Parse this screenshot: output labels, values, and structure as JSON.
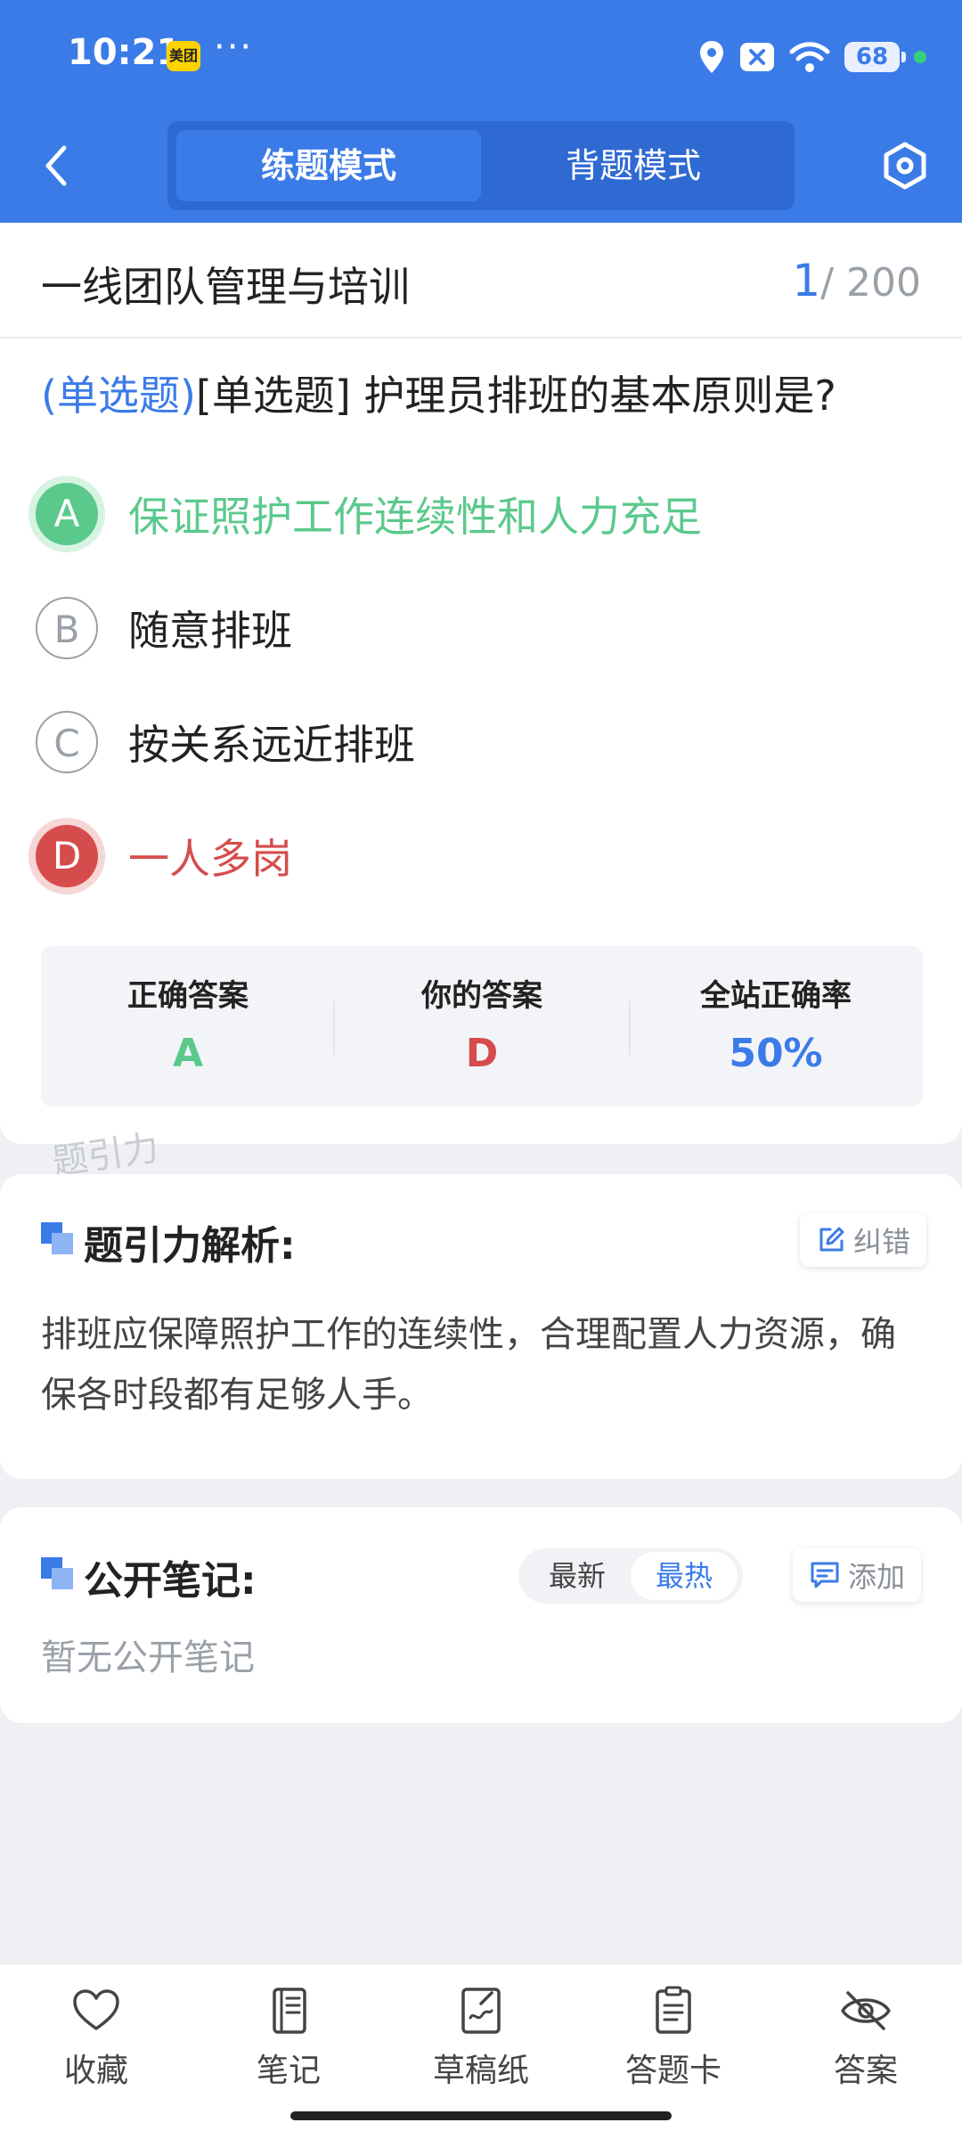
{
  "status_bar": {
    "time": "10:21",
    "app_badge": "美团",
    "more": "···",
    "battery": "68",
    "icons": [
      "location-icon",
      "close-notification-icon",
      "wifi-icon",
      "battery-icon"
    ]
  },
  "header": {
    "tabs": [
      {
        "label": "练题模式",
        "active": true
      },
      {
        "label": "背题模式",
        "active": false
      }
    ],
    "back_icon": "chevron-left-icon",
    "settings_icon": "hexagon-settings-icon"
  },
  "question_card": {
    "course_title": "一线团队管理与培训",
    "counter_current": "1",
    "counter_total": "/ 200",
    "question_type": "(单选题)",
    "question_text": "[单选题] 护理员排班的基本原则是?",
    "options": [
      {
        "letter": "A",
        "text": "保证照护工作连续性和人力充足",
        "state": "correct"
      },
      {
        "letter": "B",
        "text": "随意排班",
        "state": "normal"
      },
      {
        "letter": "C",
        "text": "按关系远近排班",
        "state": "normal"
      },
      {
        "letter": "D",
        "text": "一人多岗",
        "state": "wrong"
      }
    ],
    "stats": [
      {
        "label": "正确答案",
        "value": "A",
        "color": "#5bc98c"
      },
      {
        "label": "你的答案",
        "value": "D",
        "color": "#d64c4c"
      },
      {
        "label": "全站正确率",
        "value": "50%",
        "color": "#3b7be8"
      }
    ],
    "watermark": "题引力"
  },
  "analysis": {
    "title": "题引力解析:",
    "report_button": "纠错",
    "text": "排班应保障照护工作的连续性，合理配置人力资源，确保各时段都有足够人手。"
  },
  "notes": {
    "title": "公开笔记:",
    "sort_options": [
      {
        "label": "最新",
        "active": false
      },
      {
        "label": "最热",
        "active": true
      }
    ],
    "add_button": "添加",
    "empty_text": "暂无公开笔记"
  },
  "bottom_nav": [
    {
      "label": "收藏",
      "icon": "heart-icon"
    },
    {
      "label": "笔记",
      "icon": "notebook-icon"
    },
    {
      "label": "草稿纸",
      "icon": "draft-paper-icon"
    },
    {
      "label": "答题卡",
      "icon": "answer-sheet-icon"
    },
    {
      "label": "答案",
      "icon": "eye-off-icon"
    }
  ],
  "colors": {
    "primary": "#3b7be8",
    "correct": "#5bc98c",
    "wrong": "#d64c4c"
  }
}
